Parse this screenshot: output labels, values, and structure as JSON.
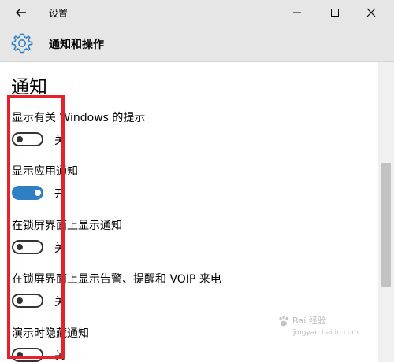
{
  "window": {
    "title": "设置"
  },
  "header": {
    "title": "通知和操作",
    "icon": "gear-icon"
  },
  "section": {
    "title": "通知"
  },
  "settings": [
    {
      "label": "显示有关 Windows 的提示",
      "state": "关",
      "on": false
    },
    {
      "label": "显示应用通知",
      "state": "开",
      "on": true
    },
    {
      "label": "在锁屏界面上显示通知",
      "state": "关",
      "on": false
    },
    {
      "label": "在锁屏界面上显示告警、提醒和 VOIP 来电",
      "state": "关",
      "on": false
    },
    {
      "label": "演示时隐藏通知",
      "state": "关",
      "on": false
    }
  ],
  "colors": {
    "accent": "#2f7fc7",
    "highlight": "#e8202a",
    "titlebar": "#e6e6e6"
  },
  "watermark": {
    "brand": "Bai 经验",
    "url": "jingyan.baidu.com"
  }
}
